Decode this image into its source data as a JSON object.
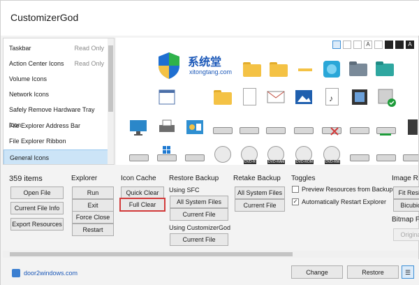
{
  "app": {
    "title": "CustomizerGod"
  },
  "list": {
    "items": [
      {
        "label": "Taskbar",
        "note": "Read Only"
      },
      {
        "label": "Action Center Icons",
        "note": "Read Only"
      },
      {
        "label": "Volume Icons",
        "note": ""
      },
      {
        "label": "Network Icons",
        "note": ""
      },
      {
        "label": "Safely Remove Hardware Tray Icon",
        "note": ""
      },
      {
        "label": "File Explorer Address Bar",
        "note": ""
      },
      {
        "label": "File Explorer Ribbon",
        "note": ""
      },
      {
        "label": "General Icons",
        "note": ""
      }
    ],
    "selected_index": 7
  },
  "grid": {
    "size_buttons": [
      "",
      "",
      "",
      "A",
      "",
      "",
      "",
      "A"
    ],
    "watermark": {
      "title": "系统堂",
      "sub": "xitongtang.com"
    },
    "drive_labels": [
      "DVD-R",
      "DVD-RAM",
      "DVD-ROM",
      "DVD-RW"
    ]
  },
  "panels": {
    "items": {
      "count": "359 items",
      "open": "Open File",
      "info": "Current File Info",
      "export": "Export Resources"
    },
    "explorer": {
      "title": "Explorer",
      "run": "Run",
      "exit": "Exit",
      "force": "Force Close",
      "restart": "Restart"
    },
    "icon_cache": {
      "title": "Icon Cache",
      "quick": "Quick Clear",
      "full": "Full Clear"
    },
    "restore": {
      "title": "Restore Backup",
      "sfc": "Using SFC",
      "all": "All System Files",
      "current": "Current File",
      "god": "Using CustomizerGod",
      "god_current": "Current File"
    },
    "retake": {
      "title": "Retake Backup",
      "all": "All System Files",
      "current": "Current File"
    },
    "toggles": {
      "title": "Toggles",
      "preview": "Preview Resources from Backup",
      "preview_checked": false,
      "restart": "Automatically Restart Explorer",
      "restart_checked": true
    },
    "image": {
      "title": "Image R",
      "fit": "Fit Resiz",
      "bicubic": "Bicubic",
      "bitmap": "Bitmap F",
      "original": "Origina"
    }
  },
  "footer": {
    "brand": "door2windows.com",
    "change": "Change",
    "restore": "Restore",
    "menu_icon": "menu-icon"
  },
  "colors": {
    "accent": "#1b58b8",
    "selection": "#cce4f7",
    "highlight": "#d23a3a"
  }
}
